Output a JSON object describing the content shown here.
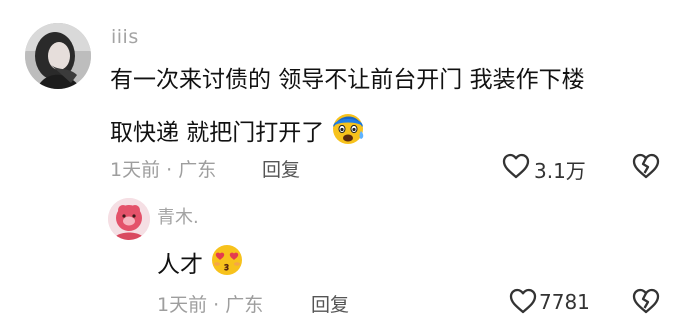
{
  "comment": {
    "username": "iiis",
    "line1": "有一次来讨债的 领导不让前台开门 我装作下楼",
    "line2": "取快递 就把门打开了",
    "emoji_icon": "cold-sweat-emoji-icon",
    "meta": "1天前 · 广东",
    "reply_label": "回复",
    "like_count": "3.1万"
  },
  "reply": {
    "username": "青木.",
    "text": "人才",
    "emoji_icon": "heart-eyes-kiss-emoji-icon",
    "meta": "1天前 · 广东",
    "reply_label": "回复",
    "like_count": "7781"
  },
  "colors": {
    "text": "#111111",
    "meta": "#9e9e9e",
    "emoji_yellow": "#f7c21c",
    "emoji_blue": "#1f7ee8",
    "heart_eyes": "#e43b4f"
  }
}
